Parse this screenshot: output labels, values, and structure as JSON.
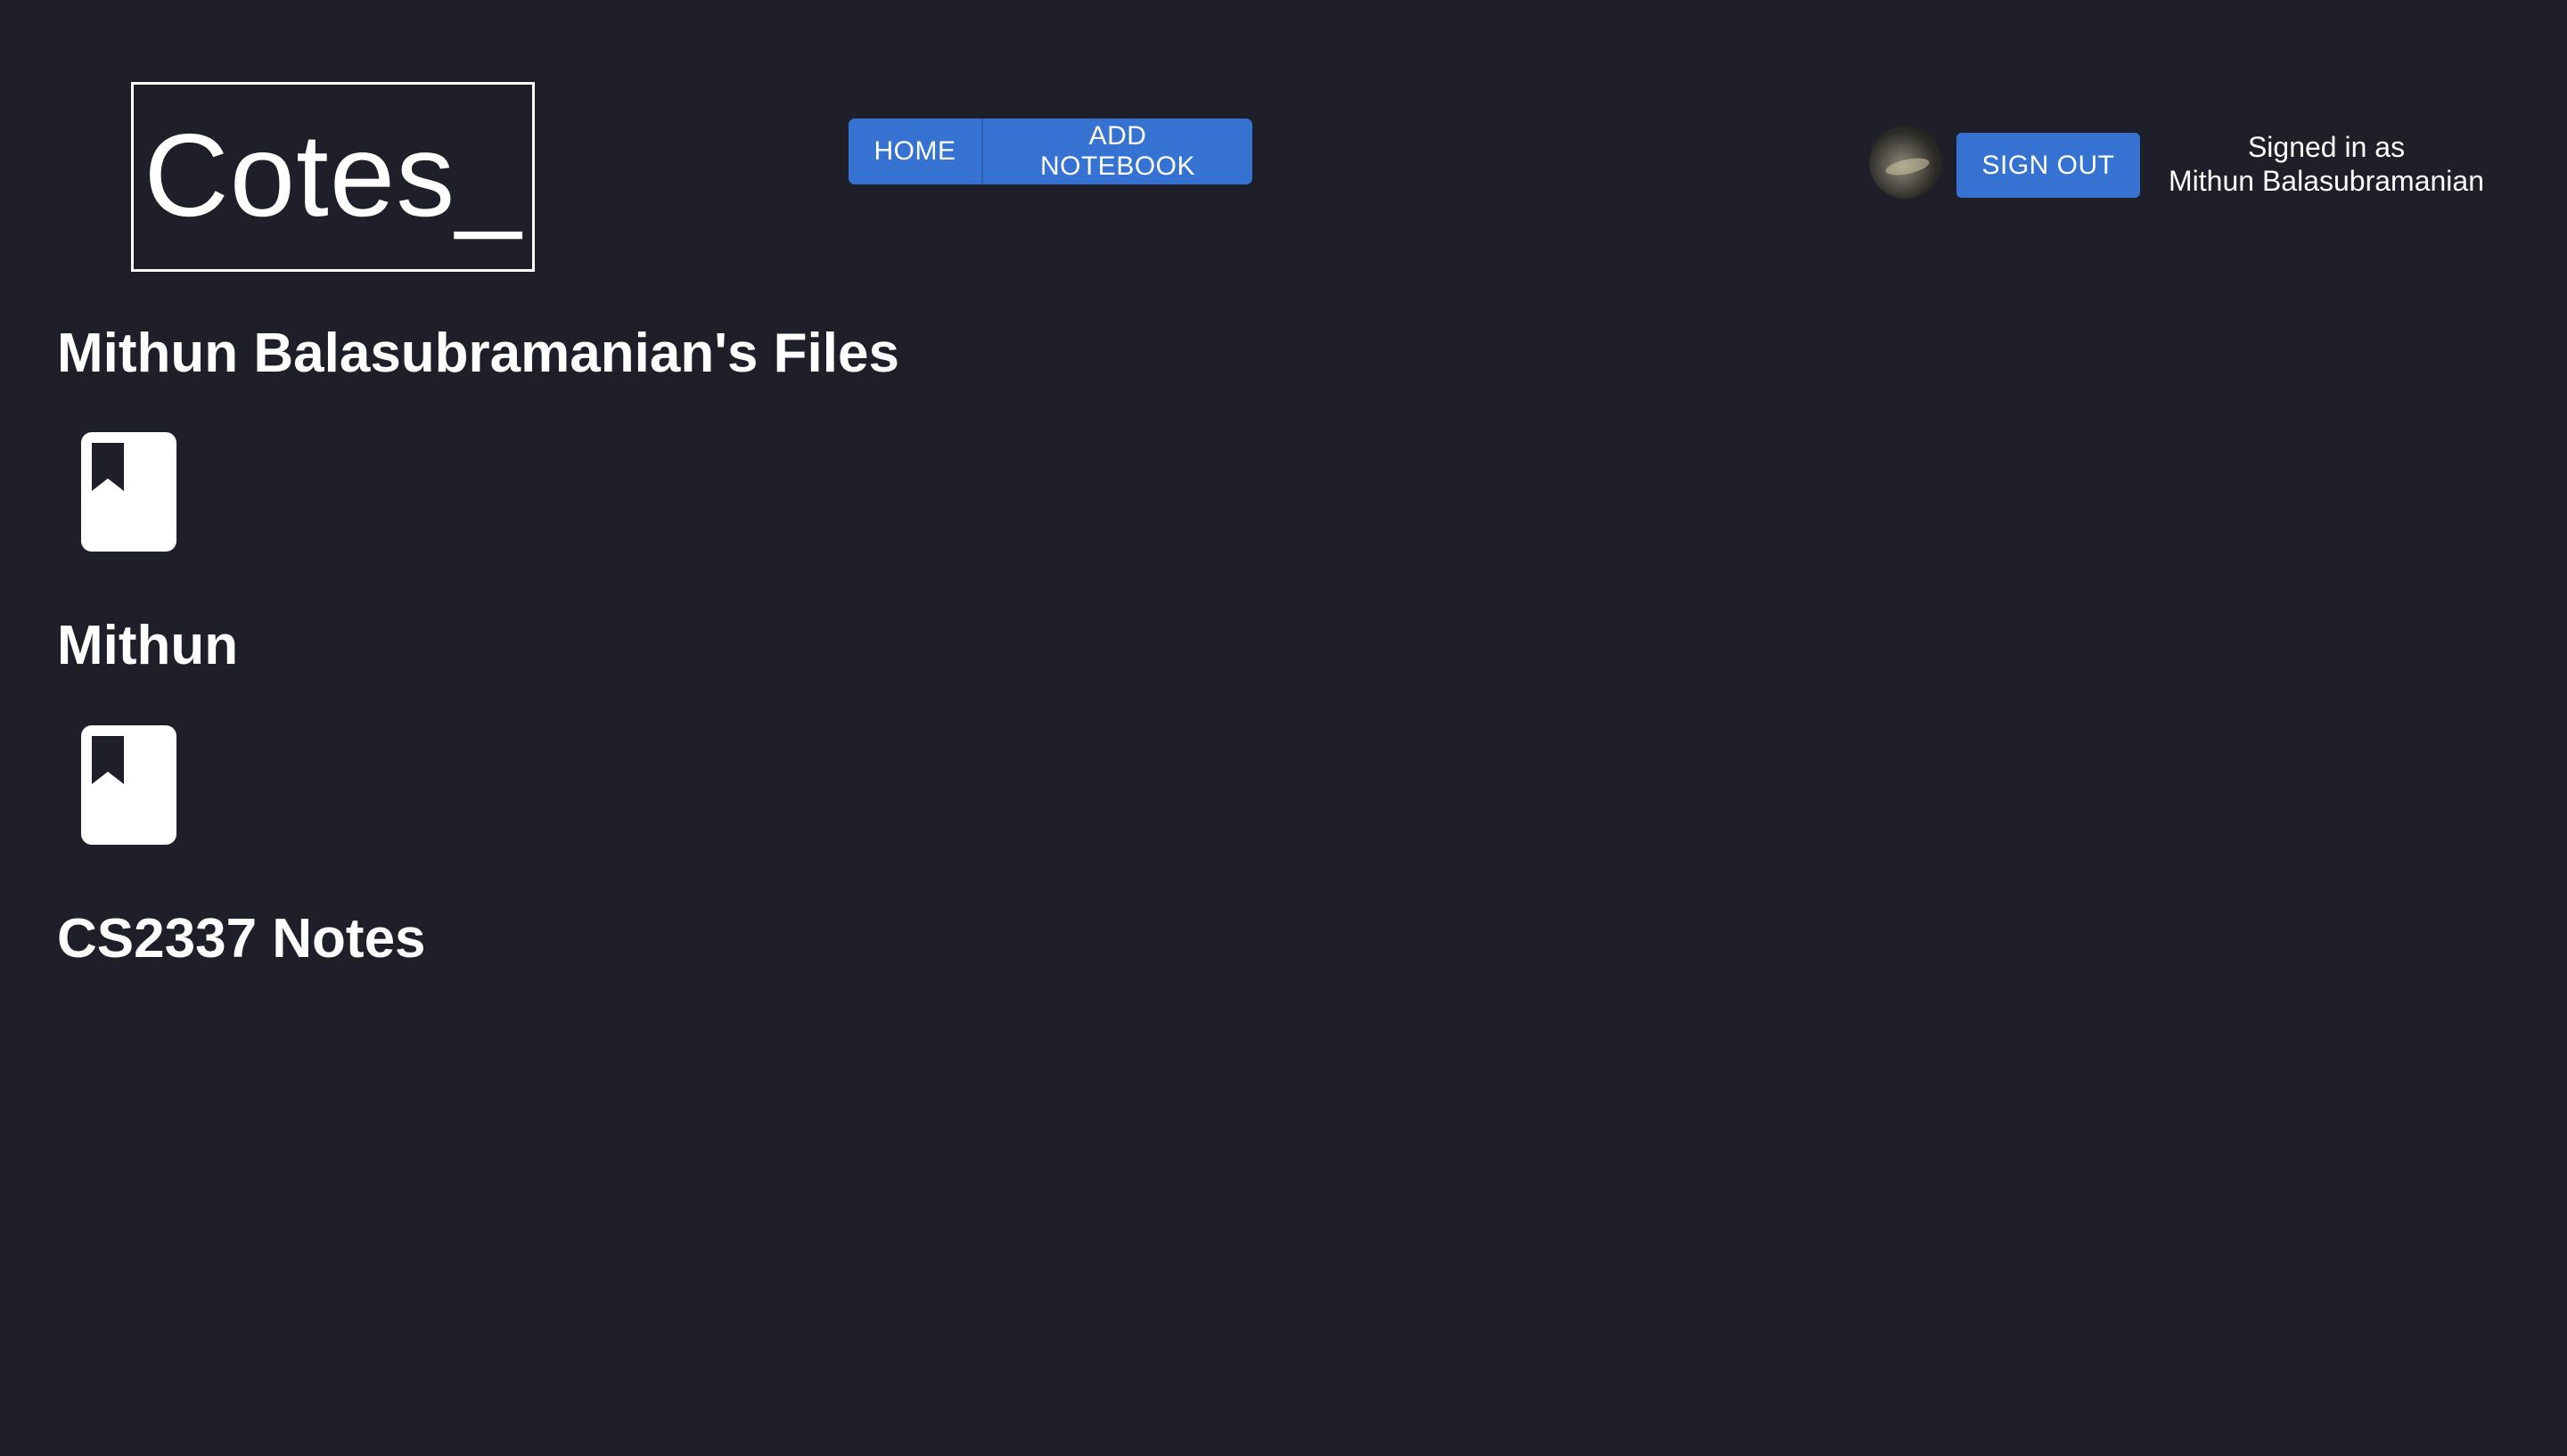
{
  "header": {
    "logo_text": "Cotes_",
    "nav": {
      "home_label": "HOME",
      "add_notebook_label": "ADD NOTEBOOK"
    },
    "user": {
      "sign_out_label": "SIGN OUT",
      "signed_in_prefix": "Signed in as",
      "user_name": "Mithun Balasubramanian"
    }
  },
  "main": {
    "page_title": "Mithun Balasubramanian's Files",
    "notebooks": [
      {
        "name": "Mithun",
        "icon": "notebook-bookmark-icon"
      },
      {
        "name": "CS2337 Notes",
        "icon": "notebook-bookmark-icon"
      }
    ]
  },
  "colors": {
    "background": "#1e1f29",
    "accent": "#3572d2",
    "text": "#ffffff"
  }
}
